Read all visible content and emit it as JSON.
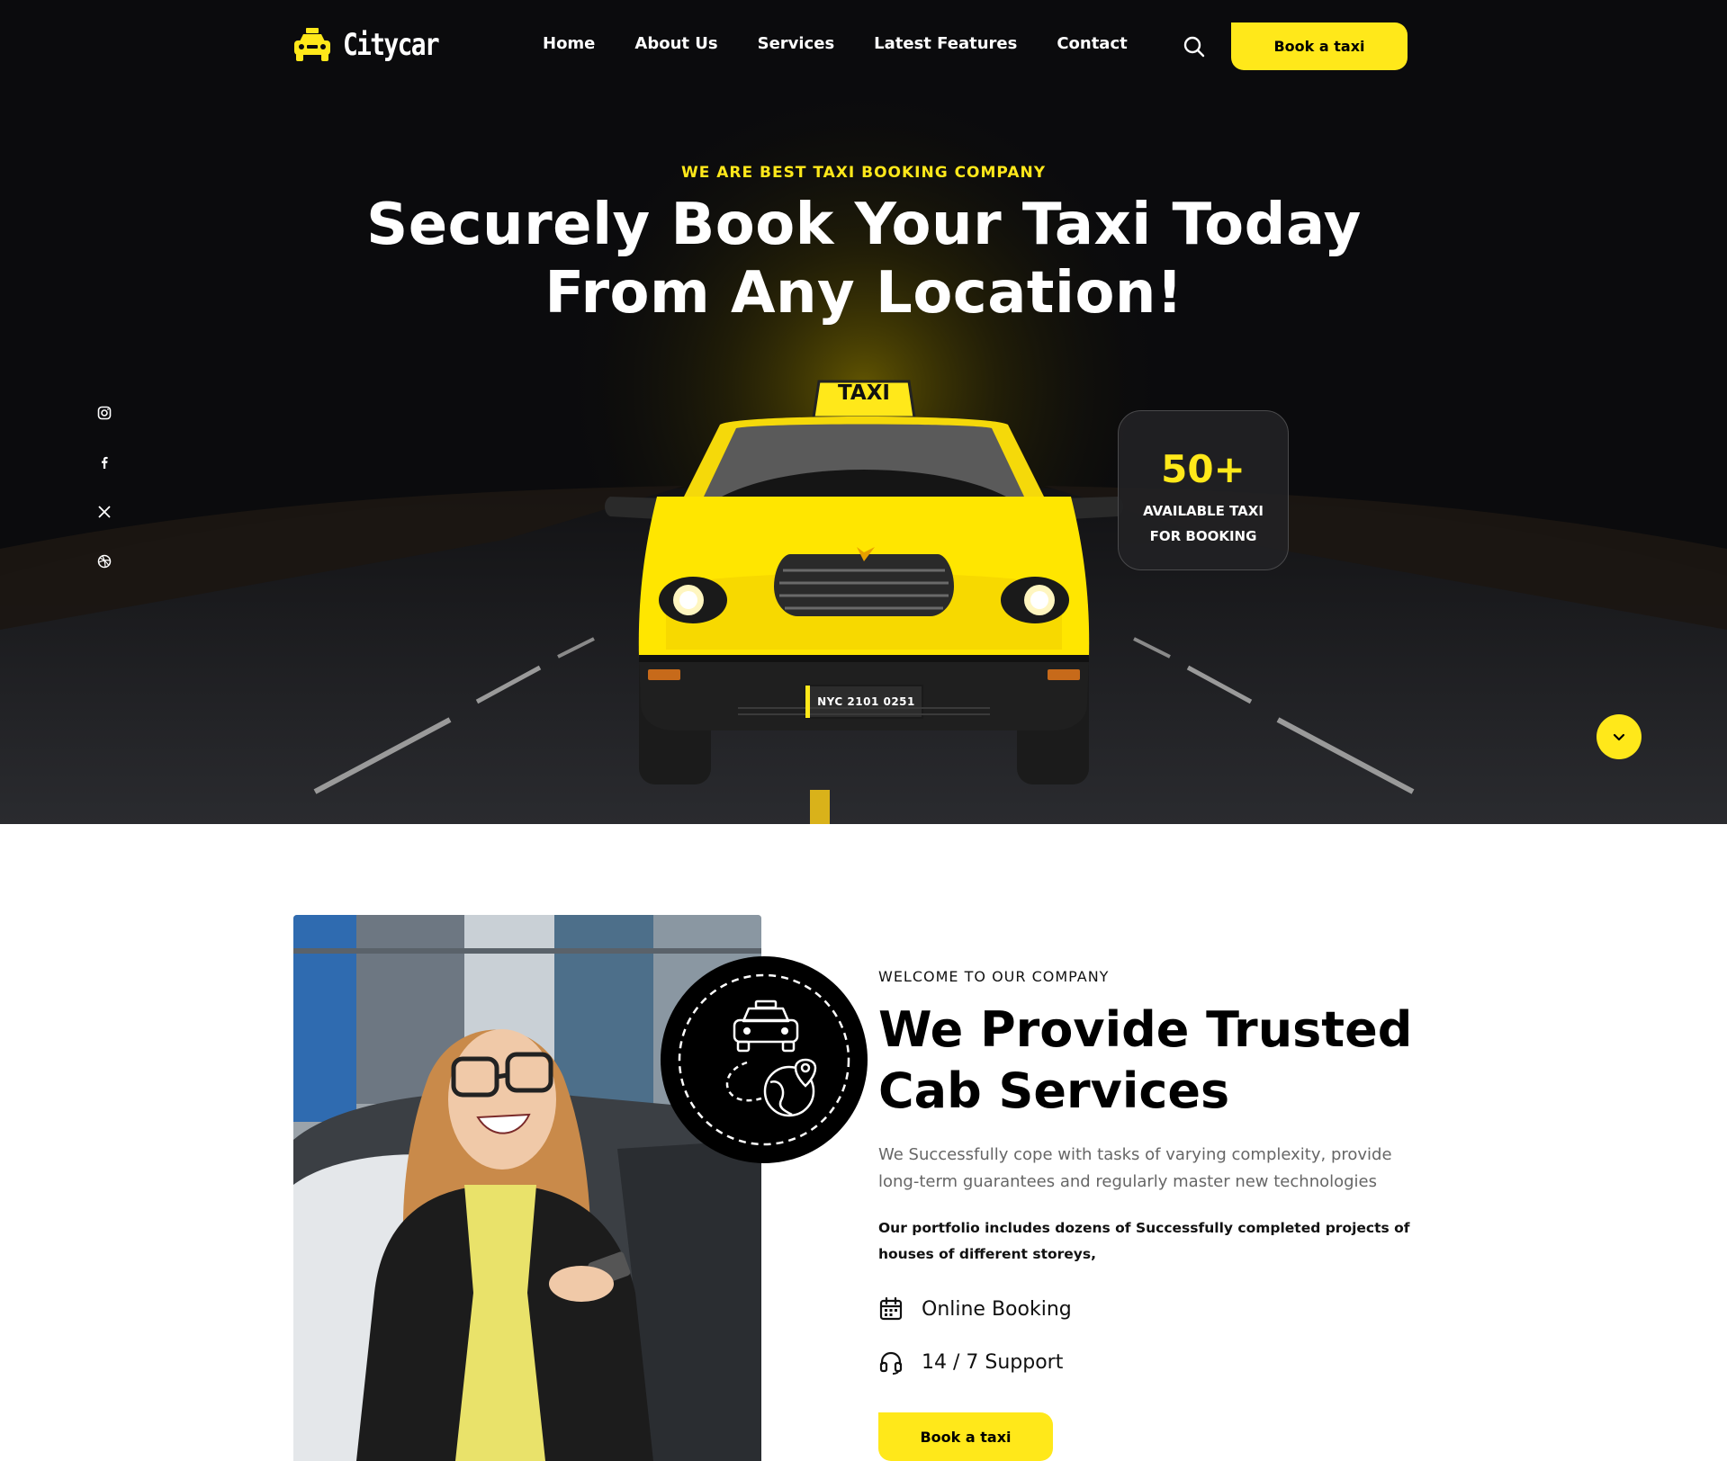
{
  "brand": {
    "name": "Citycar",
    "accent": "#ffe81a",
    "hero_bg": "#0b0b0d"
  },
  "header": {
    "nav": [
      {
        "label": "Home"
      },
      {
        "label": "About Us"
      },
      {
        "label": "Services"
      },
      {
        "label": "Latest Features"
      },
      {
        "label": "Contact"
      }
    ],
    "search_icon": "search-icon",
    "book_label": "Book a taxi"
  },
  "hero": {
    "tagline": "WE ARE BEST TAXI BOOKING COMPANY",
    "title": "Securely Book Your Taxi Today From Any Location!",
    "social": [
      "instagram-icon",
      "facebook-icon",
      "x-icon",
      "dribbble-icon"
    ],
    "taxi_sign": "TAXI",
    "plate": "NYC 2101 0251",
    "stat_value": "50+",
    "stat_label": "AVAILABLE TAXI FOR BOOKING",
    "scroll_icon": "chevron-down-icon"
  },
  "about": {
    "kicker": "WELCOME TO OUR COMPANY",
    "title": "We Provide Trusted Cab Services",
    "description": "We Successfully cope with tasks of varying complexity, provide long-term guarantees and regularly master new technologies",
    "bold_text": "Our portfolio includes dozens of Successfully completed projects of houses of different storeys,",
    "features": [
      {
        "icon": "calendar-icon",
        "label": "Online Booking"
      },
      {
        "icon": "headset-icon",
        "label": "14 / 7 Support"
      }
    ],
    "badge_icon": "taxi-route-icon",
    "book_label": "Book a taxi"
  }
}
